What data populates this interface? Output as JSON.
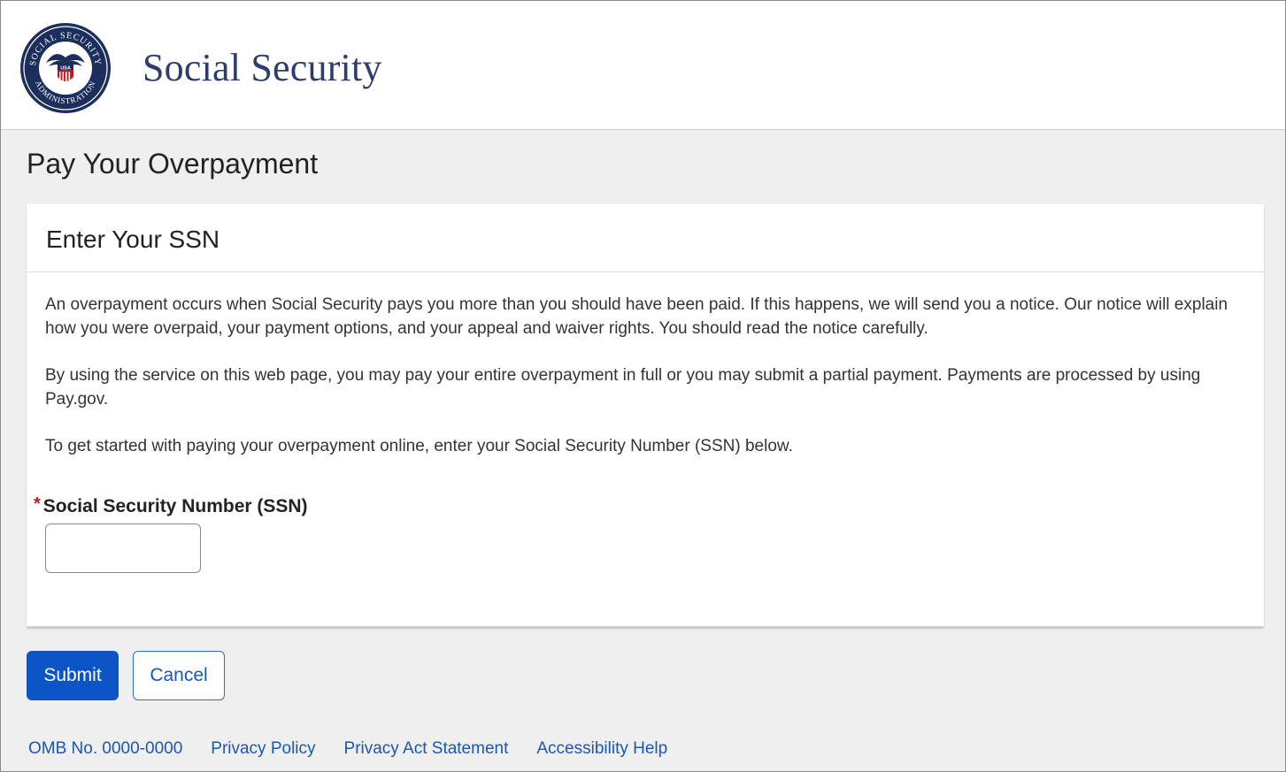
{
  "header": {
    "seal_text_top": "SOCIAL SECURITY",
    "seal_text_bottom": "ADMINISTRATION",
    "seal_usa": "USA",
    "site_title": "Social Security"
  },
  "page": {
    "title": "Pay Your Overpayment"
  },
  "card": {
    "title": "Enter Your SSN",
    "paragraphs": [
      "An overpayment occurs when Social Security pays you more than you should have been paid. If this happens, we will send you a notice. Our notice will explain how you were overpaid, your payment options, and your appeal and waiver rights. You should read the notice carefully.",
      "By using the service on this web page, you may pay your entire overpayment in full or you may submit a partial payment. Payments are processed by using Pay.gov.",
      "To get started with paying your overpayment online, enter your Social Security Number (SSN) below."
    ],
    "field": {
      "required_mark": "*",
      "label": "Social Security Number (SSN)",
      "value": ""
    }
  },
  "actions": {
    "submit_label": "Submit",
    "cancel_label": "Cancel"
  },
  "footer": {
    "links": [
      "OMB No. 0000-0000",
      "Privacy Policy",
      "Privacy Act Statement",
      "Accessibility Help"
    ]
  },
  "colors": {
    "brand_navy": "#2c3e6e",
    "primary_button": "#0b55c7",
    "link": "#1a57b5",
    "required": "#c0171f"
  }
}
